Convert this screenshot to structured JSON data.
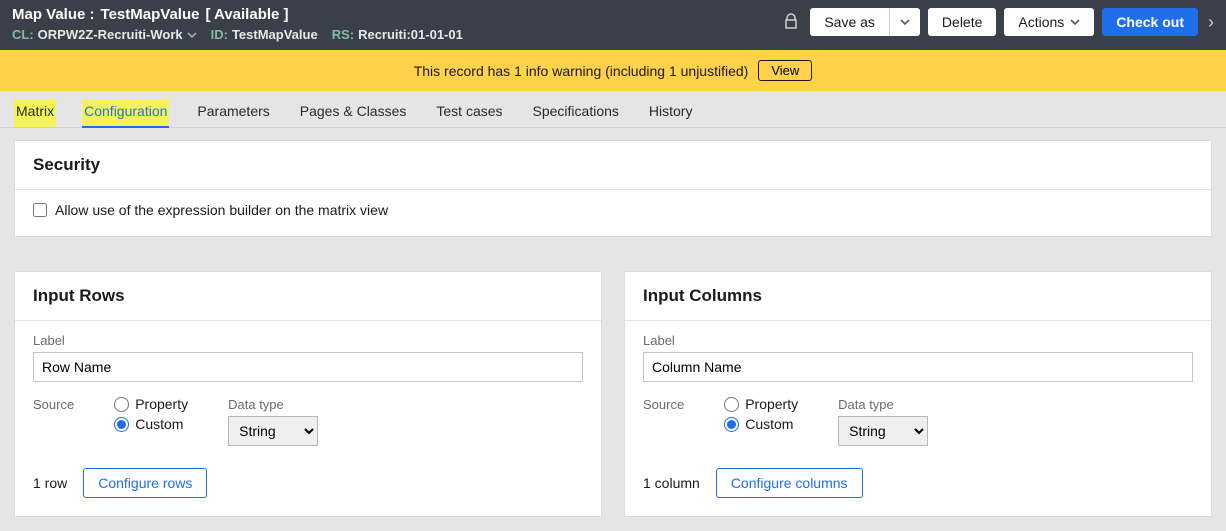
{
  "header": {
    "type_label": "Map Value :",
    "name": "TestMapValue",
    "status": "[ Available ]",
    "cl_label": "CL:",
    "cl_value": "ORPW2Z-Recruiti-Work",
    "id_label": "ID:",
    "id_value": "TestMapValue",
    "rs_label": "RS:",
    "rs_value": "Recruiti:01-01-01",
    "save_as": "Save as",
    "delete": "Delete",
    "actions": "Actions",
    "checkout": "Check out"
  },
  "warning": {
    "text": "This record has 1 info warning (including 1 unjustified)",
    "view": "View"
  },
  "tabs": [
    "Matrix",
    "Configuration",
    "Parameters",
    "Pages & Classes",
    "Test cases",
    "Specifications",
    "History"
  ],
  "security": {
    "title": "Security",
    "checkbox_label": "Allow use of the expression builder on the matrix view",
    "checked": false
  },
  "input_rows": {
    "title": "Input Rows",
    "label_field": "Label",
    "label_value": "Row Name",
    "source_label": "Source",
    "radio_property": "Property",
    "radio_custom": "Custom",
    "source_selected": "custom",
    "datatype_label": "Data type",
    "datatype_value": "String",
    "count_text": "1 row",
    "configure": "Configure rows"
  },
  "input_columns": {
    "title": "Input Columns",
    "label_field": "Label",
    "label_value": "Column Name",
    "source_label": "Source",
    "radio_property": "Property",
    "radio_custom": "Custom",
    "source_selected": "custom",
    "datatype_label": "Data type",
    "datatype_value": "String",
    "count_text": "1 column",
    "configure": "Configure columns"
  }
}
